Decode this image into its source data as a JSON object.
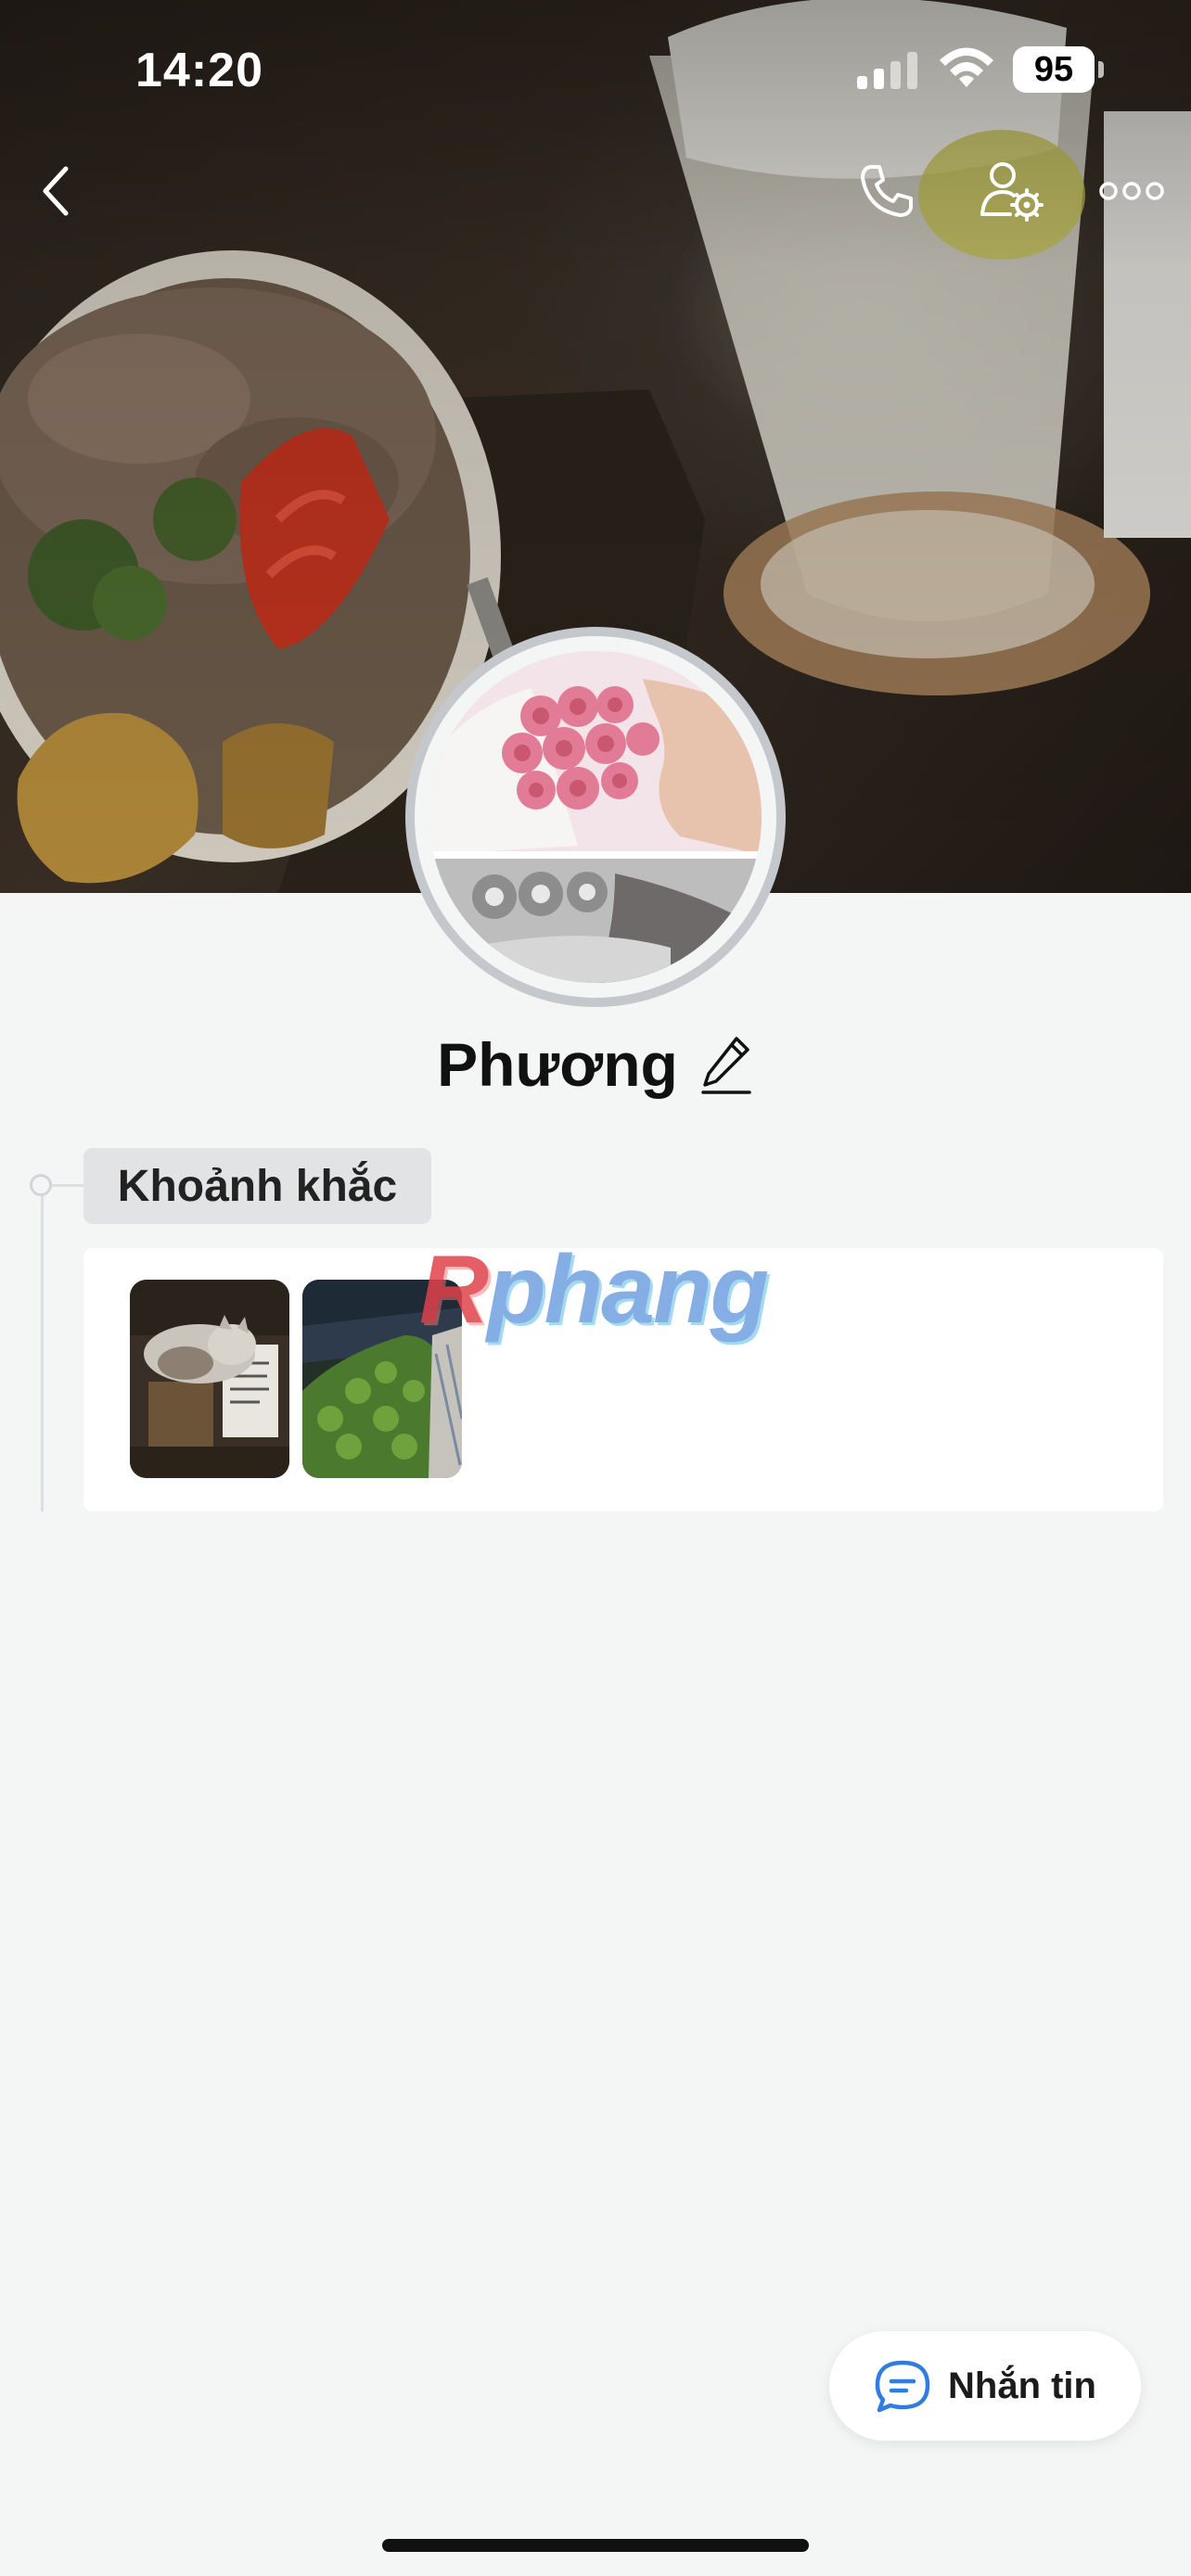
{
  "status_bar": {
    "time": "14:20",
    "battery": "95",
    "signal_icon": "cellular-signal-icon",
    "wifi_icon": "wifi-icon"
  },
  "nav": {
    "back_icon": "chevron-left-icon",
    "call_icon": "phone-icon",
    "settings_icon": "user-settings-icon",
    "more_icon": "more-horizontal-icon"
  },
  "profile": {
    "name": "Phương",
    "edit_icon": "pencil-icon"
  },
  "moments": {
    "label": "Khoảnh khắc",
    "thumbnails": [
      "cat-photo",
      "plant-photo"
    ]
  },
  "watermark": {
    "first": "R",
    "rest": "phang"
  },
  "message_button": {
    "label": "Nhắn tin",
    "icon": "chat-bubble-icon"
  },
  "colors": {
    "background": "#f4f5f5",
    "accent": "#2f7de1",
    "card": "#ffffff"
  }
}
